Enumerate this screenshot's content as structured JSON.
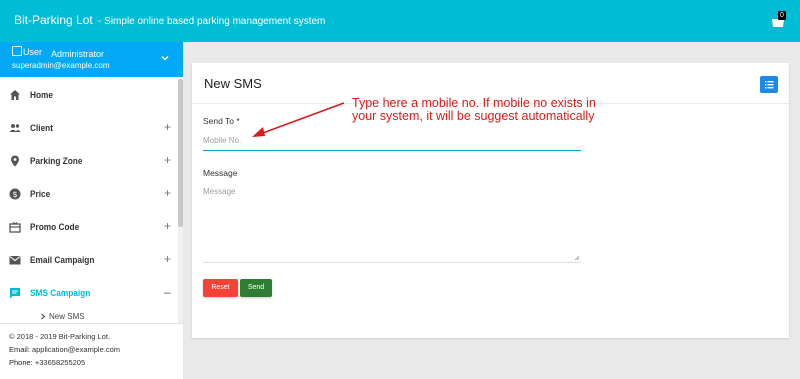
{
  "header": {
    "app_name": "Bit-Parking Lot",
    "tagline": "- Simple online based parking management system",
    "cart_count": "0",
    "cart_icon": "cart-icon"
  },
  "user": {
    "avatar_alt": "User",
    "name": "Administrator",
    "email": "superadmin@example.com"
  },
  "sidebar": {
    "items": [
      {
        "label": "Home",
        "icon": "home-icon",
        "toggle": ""
      },
      {
        "label": "Client",
        "icon": "people-icon",
        "toggle": "+"
      },
      {
        "label": "Parking Zone",
        "icon": "location-pin-icon",
        "toggle": "+"
      },
      {
        "label": "Price",
        "icon": "dollar-icon",
        "toggle": "+"
      },
      {
        "label": "Promo Code",
        "icon": "gift-card-icon",
        "toggle": "+"
      },
      {
        "label": "Email Campaign",
        "icon": "mail-icon",
        "toggle": "+"
      },
      {
        "label": "SMS Campaign",
        "icon": "message-icon",
        "toggle": "–"
      }
    ],
    "submenu_item": "New SMS",
    "active_color": "#00bcd4"
  },
  "footer": {
    "copyright": "© 2018 - 2019 Bit-Parking Lot.",
    "email_label": "Email:",
    "email_value": "application@example.com",
    "phone_label": "Phone:",
    "phone_value": "+33658255205"
  },
  "card": {
    "title": "New SMS",
    "send_to_label": "Send To *",
    "send_to_placeholder": "Mobile No.",
    "message_label": "Message",
    "message_placeholder": "Message",
    "reset_label": "Reset",
    "send_label": "Send"
  },
  "annotation": {
    "line1": "Type here a mobile no. If mobile no exists in",
    "line2": "your system, it will be suggest automatically"
  },
  "colors": {
    "topbar": "#00bcd4",
    "userbox": "#03a9f4",
    "reset": "#f44336",
    "send": "#2e7d32",
    "annotation": "#d81b1b"
  }
}
